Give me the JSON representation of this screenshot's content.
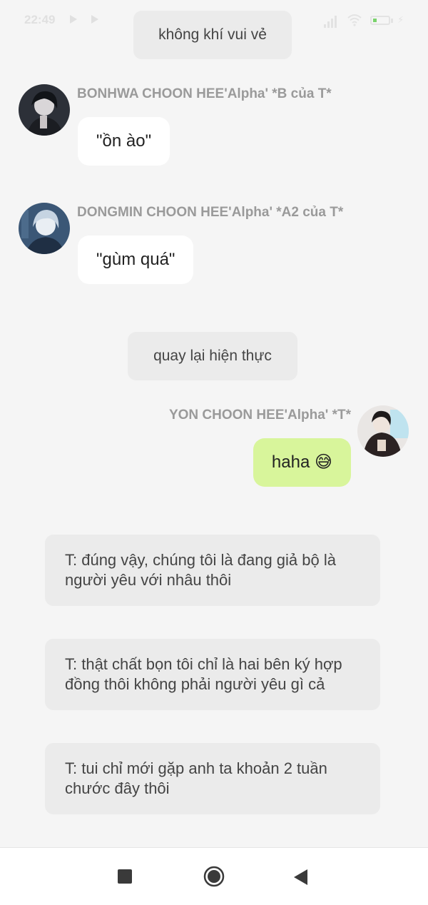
{
  "status_bar": {
    "time": "22:49"
  },
  "messages": {
    "pill_1": "không khí vui vẻ",
    "msg_1": {
      "sender": "BONHWA CHOON HEE'Alpha' *B của T*",
      "text": "\"ồn ào\""
    },
    "msg_2": {
      "sender": "DONGMIN CHOON HEE'Alpha' *A2 của T*",
      "text": "\"gùm quá\""
    },
    "pill_2": "quay lại hiện thực",
    "msg_3": {
      "sender": "YON CHOON HEE'Alpha' *T*",
      "text": "haha 😅"
    },
    "note_1": "T: đúng vậy, chúng tôi là đang giả bộ là người yêu với nhâu thôi",
    "note_2": "T: thật chất bọn tôi chỉ là hai bên ký hợp đồng thôi không phải người yêu gì cả",
    "note_3": "T: tui chỉ mới gặp anh ta khoản 2 tuần chước đây thôi"
  },
  "colors": {
    "mine_bubble": "#d8f59b",
    "other_bubble": "#ffffff",
    "pill_bg": "#ebebeb",
    "background": "#f5f5f5"
  },
  "icons": {
    "nav": [
      "recent-apps-icon",
      "home-icon",
      "back-icon"
    ]
  }
}
